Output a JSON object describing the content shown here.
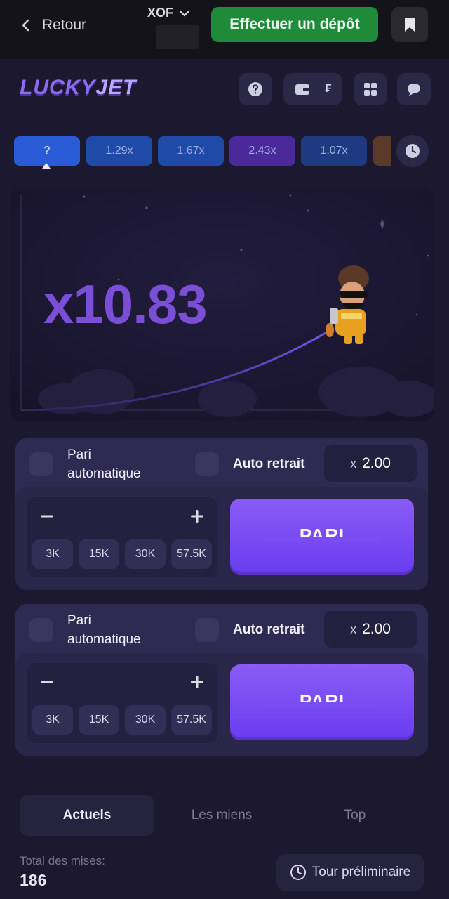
{
  "topbar": {
    "back_label": "Retour",
    "currency": "XOF",
    "deposit_label": "Effectuer un dépôt"
  },
  "header": {
    "logo_part1": "LUCKY",
    "logo_part2": "JET",
    "wallet_currency_symbol": "₣"
  },
  "history": [
    {
      "label": "?",
      "color": "#2a5bd7"
    },
    {
      "label": "1.29x",
      "color": "#1f4aa8"
    },
    {
      "label": "1.67x",
      "color": "#1f4aa8"
    },
    {
      "label": "2.43x",
      "color": "#4a2a9a"
    },
    {
      "label": "1.07x",
      "color": "#1f3a80"
    }
  ],
  "game": {
    "multiplier": "x10.83"
  },
  "bet_panels": [
    {
      "auto_bet_label_line1": "Pari",
      "auto_bet_label_line2": "automatique",
      "auto_cashout_label": "Auto retrait",
      "cashout_prefix": "x",
      "cashout_value": "2.00",
      "amount_value": "",
      "quick_amounts": [
        "3K",
        "15K",
        "30K",
        "57.5K"
      ],
      "bet_button_label": "PARI"
    },
    {
      "auto_bet_label_line1": "Pari",
      "auto_bet_label_line2": "automatique",
      "auto_cashout_label": "Auto retrait",
      "cashout_prefix": "x",
      "cashout_value": "2.00",
      "amount_value": "",
      "quick_amounts": [
        "3K",
        "15K",
        "30K",
        "57.5K"
      ],
      "bet_button_label": "PARI"
    }
  ],
  "tabs": [
    {
      "label": "Actuels",
      "active": true
    },
    {
      "label": "Les miens",
      "active": false
    },
    {
      "label": "Top",
      "active": false
    }
  ],
  "stats": {
    "total_label": "Total des mises:",
    "total_value": "186",
    "round_button_label": "Tour préliminaire"
  }
}
